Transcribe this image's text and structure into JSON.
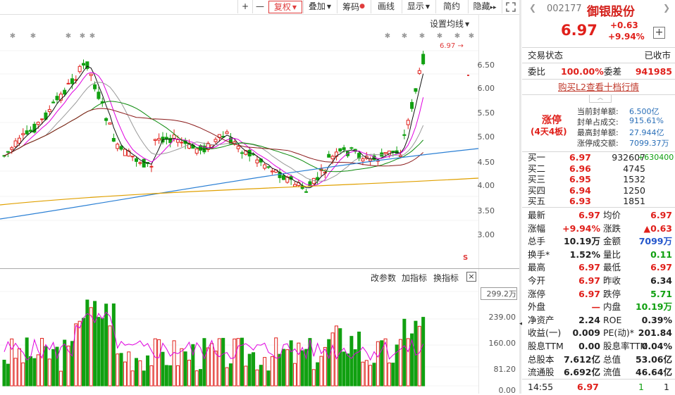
{
  "toolbar": {
    "plus": "+",
    "minus": "—",
    "fq": "复权",
    "overlay": "叠加",
    "chips": "筹码",
    "draw": "画线",
    "show": "显示",
    "simple": "简约",
    "hide": "隐藏",
    "more": "▸▸"
  },
  "chart": {
    "set_ma": "设置均线",
    "price_marker": "6.97",
    "y_labels": [
      "6.50",
      "6.00",
      "5.50",
      "5.00",
      "4.50",
      "4.00",
      "3.50",
      "3.00"
    ],
    "vol_labels": [
      "299.2万",
      "239.00",
      "160.00",
      "81.20",
      "0.00"
    ],
    "mid_buttons": [
      "改参数",
      "加指标",
      "换指标"
    ],
    "close_icon": "×",
    "s_mark": "S"
  },
  "quote": {
    "code": "002177",
    "name": "御银股份",
    "price": "6.97",
    "change": "+0.63",
    "change_pct": "+9.94%",
    "status_label": "交易状态",
    "status_value": "已收市",
    "weibi_label": "委比",
    "weibi_value": "100.00%",
    "weicha_label": "委差",
    "weicha_value": "941985",
    "l2_link": "购买L2查看十档行情",
    "limit_title": "涨停",
    "limit_sub": "(4天4板)",
    "limit_info": [
      {
        "label": "当前封单额:",
        "value": "6.500亿"
      },
      {
        "label": "封单占成交:",
        "value": "915.61%"
      },
      {
        "label": "最高封单额:",
        "value": "27.944亿"
      },
      {
        "label": "涨停成交额:",
        "value": "7099.37万"
      }
    ],
    "bids": [
      {
        "label": "买一",
        "price": "6.97",
        "vol": "932607",
        "extra": "+630400"
      },
      {
        "label": "买二",
        "price": "6.96",
        "vol": "4745",
        "extra": ""
      },
      {
        "label": "买三",
        "price": "6.95",
        "vol": "1532",
        "extra": ""
      },
      {
        "label": "买四",
        "price": "6.94",
        "vol": "1250",
        "extra": ""
      },
      {
        "label": "买五",
        "price": "6.93",
        "vol": "1851",
        "extra": ""
      }
    ],
    "stats": [
      {
        "l1": "最新",
        "v1": "6.97",
        "c1": "red",
        "l2": "均价",
        "v2": "6.97",
        "c2": "red"
      },
      {
        "l1": "涨幅",
        "v1": "+9.94%",
        "c1": "red",
        "l2": "涨跌",
        "v2": "▲0.63",
        "c2": "red"
      },
      {
        "l1": "总手",
        "v1": "10.19万",
        "c1": "dark",
        "l2": "金额",
        "v2": "7099万",
        "c2": "blue"
      },
      {
        "l1": "换手*",
        "v1": "1.52%",
        "c1": "dark",
        "l2": "量比",
        "v2": "0.11",
        "c2": "green"
      },
      {
        "l1": "最高",
        "v1": "6.97",
        "c1": "red",
        "l2": "最低",
        "v2": "6.97",
        "c2": "red"
      },
      {
        "l1": "今开",
        "v1": "6.97",
        "c1": "red",
        "l2": "昨收",
        "v2": "6.34",
        "c2": "dark"
      },
      {
        "l1": "涨停",
        "v1": "6.97",
        "c1": "red",
        "l2": "跌停",
        "v2": "5.71",
        "c2": "green"
      },
      {
        "l1": "外盘",
        "v1": "—",
        "c1": "red",
        "l2": "内盘",
        "v2": "10.19万",
        "c2": "green"
      },
      {
        "l1": "净资产",
        "v1": "2.24",
        "c1": "dark",
        "l2": "ROE",
        "v2": "0.39%",
        "c2": "dark"
      },
      {
        "l1": "收益(一)",
        "v1": "0.009",
        "c1": "dark",
        "l2": "PE(动)*",
        "v2": "201.84",
        "c2": "dark"
      },
      {
        "l1": "股息TTM",
        "v1": "0.00",
        "c1": "dark",
        "l2": "股息率TTM",
        "v2": "0.04%",
        "c2": "dark"
      },
      {
        "l1": "总股本",
        "v1": "7.612亿",
        "c1": "dark",
        "l2": "总值",
        "v2": "53.06亿",
        "c2": "dark"
      },
      {
        "l1": "流通股",
        "v1": "6.692亿",
        "c1": "dark",
        "l2": "流值",
        "v2": "46.64亿",
        "c2": "dark"
      }
    ],
    "trade": {
      "time": "14:55",
      "price": "6.97",
      "vol": "1",
      "num": "1"
    }
  },
  "colors": {
    "up": "#e0201b",
    "down": "#11a011",
    "accent": "#e03c3c"
  }
}
